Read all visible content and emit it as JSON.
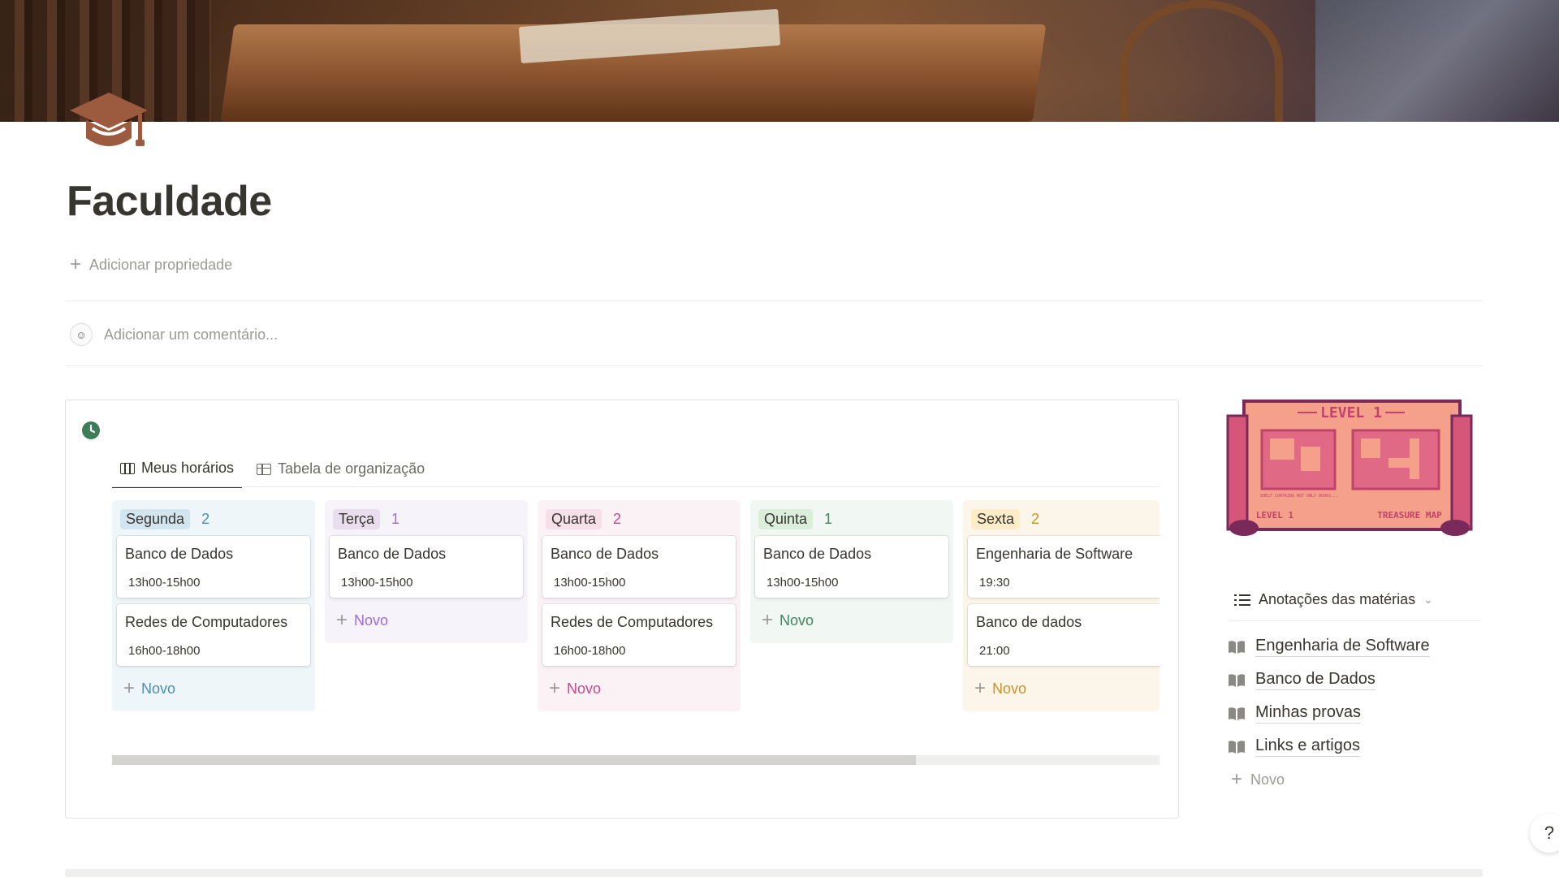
{
  "page": {
    "title": "Faculdade",
    "add_property": "Adicionar propriedade",
    "add_comment": "Adicionar um comentário..."
  },
  "board": {
    "tabs": [
      {
        "label": "Meus horários",
        "icon": "board-icon",
        "active": true
      },
      {
        "label": "Tabela de organização",
        "icon": "table-icon",
        "active": false
      }
    ],
    "new_label": "Novo",
    "columns": [
      {
        "name": "Segunda",
        "count": "2",
        "bg": "#eef6fa",
        "pill": "#d3e5ef",
        "count_color": "#4c8db5",
        "cards": [
          {
            "title": "Banco de Dados",
            "time": "13h00-15h00"
          },
          {
            "title": "Redes de Computadores",
            "time": "16h00-18h00"
          }
        ]
      },
      {
        "name": "Terça",
        "count": "1",
        "bg": "#f7f3fa",
        "pill": "#e8deee",
        "count_color": "#9a6dd7",
        "cards": [
          {
            "title": "Banco de Dados",
            "time": "13h00-15h00"
          }
        ]
      },
      {
        "name": "Quarta",
        "count": "2",
        "bg": "#fbf2f6",
        "pill": "#f5e0e9",
        "count_color": "#c14c8a",
        "cards": [
          {
            "title": "Banco de Dados",
            "time": "13h00-15h00"
          },
          {
            "title": "Redes de Computadores",
            "time": "16h00-18h00"
          }
        ]
      },
      {
        "name": "Quinta",
        "count": "1",
        "bg": "#f1f7f3",
        "pill": "#dbeddb",
        "count_color": "#448361",
        "cards": [
          {
            "title": "Banco de Dados",
            "time": "13h00-15h00"
          }
        ]
      },
      {
        "name": "Sexta",
        "count": "2",
        "bg": "#fcf6ea",
        "pill": "#fdecc8",
        "count_color": "#cb912f",
        "cards": [
          {
            "title": "Engenharia de Software",
            "time": "19:30"
          },
          {
            "title": "Banco de dados",
            "time": "21:00"
          }
        ]
      }
    ]
  },
  "notes": {
    "header": "Anotações das matérias",
    "items": [
      "Engenharia de Software",
      "Banco de Dados",
      "Minhas provas",
      "Links e artigos"
    ],
    "new_label": "Novo"
  },
  "level_image": {
    "title": "LEVEL 1",
    "left_label": "LEVEL 1",
    "right_label": "TREASURE MAP",
    "small_text": "SHELF CONTAINS NOT ONLY BOOKS..."
  },
  "help": "?"
}
